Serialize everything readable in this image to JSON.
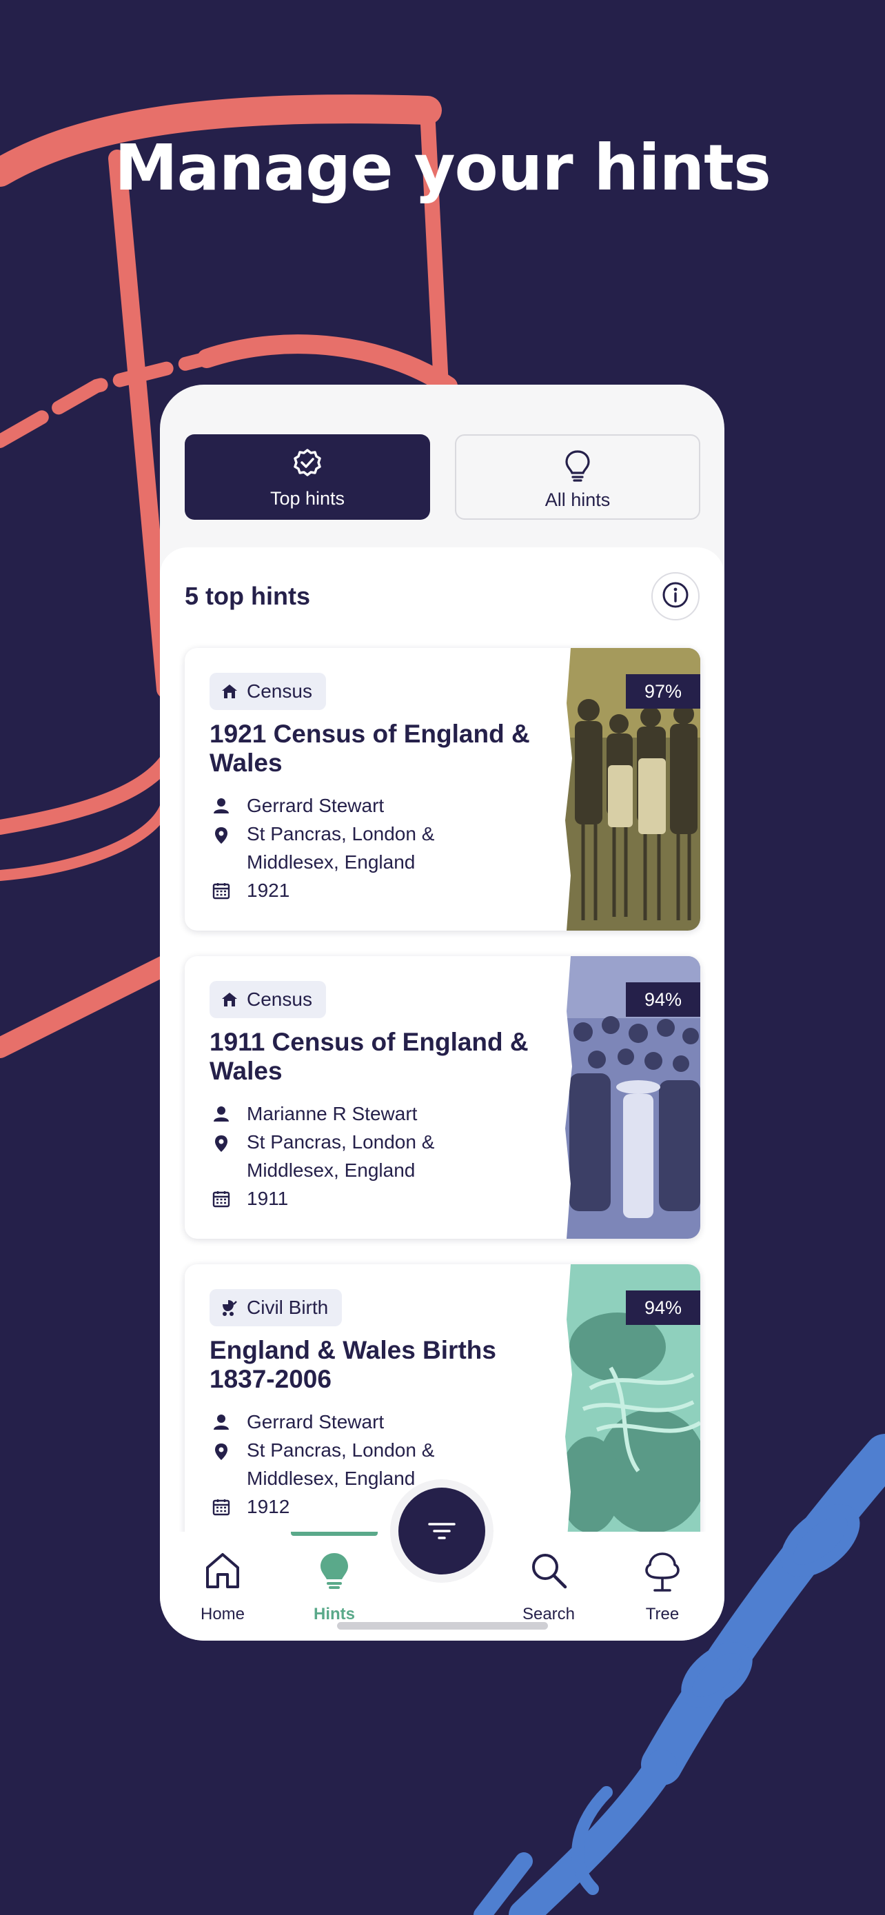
{
  "headline": "Manage your hints",
  "colors": {
    "navy": "#25204a",
    "coral": "#e7706a",
    "blue": "#4f7fd0",
    "green": "#5aa98a"
  },
  "segments": [
    {
      "label": "Top hints",
      "icon": "rosette-check-icon",
      "selected": true
    },
    {
      "label": "All hints",
      "icon": "lightbulb-icon",
      "selected": false
    }
  ],
  "list": {
    "count_label": "5 top hints",
    "info_icon": "info-icon"
  },
  "cards": [
    {
      "tag": "Census",
      "tag_icon": "house-icon",
      "title": "1921 Census of England & Wales",
      "name": "Gerrard Stewart",
      "place_line1": "St Pancras, London &",
      "place_line2": "Middlesex, England",
      "year": "1921",
      "match": "97%"
    },
    {
      "tag": "Census",
      "tag_icon": "house-icon",
      "title": "1911 Census of England & Wales",
      "name": "Marianne R Stewart",
      "place_line1": "St Pancras, London &",
      "place_line2": "Middlesex, England",
      "year": "1911",
      "match": "94%"
    },
    {
      "tag": "Civil Birth",
      "tag_icon": "pram-icon",
      "title": "England & Wales Births 1837-2006",
      "name": "Gerrard Stewart",
      "place_line1": "St Pancras, London &",
      "place_line2": "Middlesex, England",
      "year": "1912",
      "match": "94%"
    }
  ],
  "tabbar": {
    "items": [
      {
        "label": "Home",
        "icon": "home-icon",
        "active": false
      },
      {
        "label": "Hints",
        "icon": "lightbulb-icon",
        "active": true
      },
      {
        "label": "Search",
        "icon": "search-icon",
        "active": false
      },
      {
        "label": "Tree",
        "icon": "tree-icon",
        "active": false
      }
    ],
    "fab_icon": "filter-icon"
  }
}
